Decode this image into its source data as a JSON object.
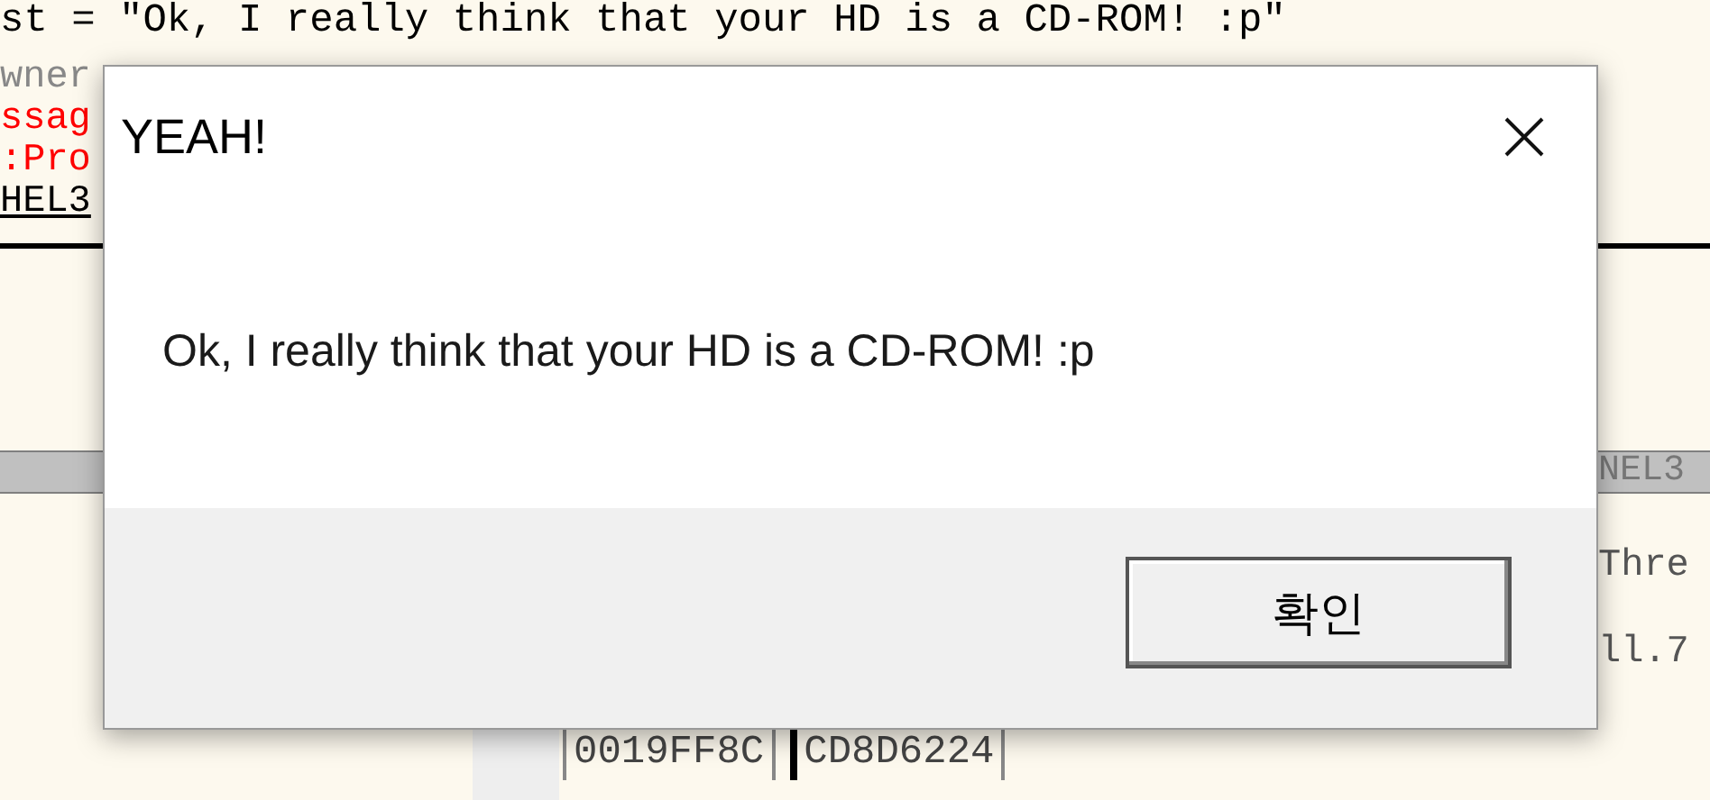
{
  "background_debugger": {
    "code_line": "st = \"Ok, I really think that your HD is a CD-ROM! :p\"",
    "left_fragments": [
      {
        "text": "wner",
        "kind": "plain"
      },
      {
        "text": "ssag",
        "kind": "error"
      },
      {
        "text": ":Pro",
        "kind": "error"
      },
      {
        "text": "HEL3",
        "kind": "heading"
      }
    ],
    "right_header": "NEL3",
    "right_fragments": [
      "Thre",
      "ll.7"
    ],
    "stack_row": [
      "0019FF8C",
      "CD8D6224"
    ]
  },
  "dialog": {
    "title": "YEAH!",
    "message": "Ok, I really think that your HD is a CD-ROM! :p",
    "buttons": [
      {
        "label": "확인",
        "default": true
      }
    ]
  }
}
